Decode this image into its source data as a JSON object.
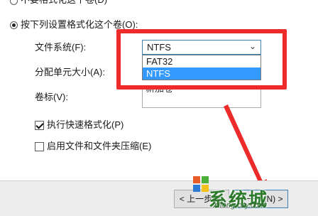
{
  "options": {
    "no_format_label": "不要格式化这个卷(D)",
    "format_label": "按下列设置格式化这个卷(O):"
  },
  "fields": {
    "filesystem_label": "文件系统(F):",
    "filesystem_value": "NTFS",
    "filesystem_options": [
      "FAT32",
      "NTFS"
    ],
    "allocation_label": "分配单元大小(A):",
    "volume_label_label": "卷标(V):",
    "volume_label_value": "新加卷"
  },
  "checkboxes": {
    "quick_format_label": "执行快速格式化(P)",
    "quick_format_checked": true,
    "compression_label": "启用文件和文件夹压缩(E)",
    "compression_checked": false
  },
  "footer": {
    "back_label": "< 上一步(B)",
    "next_label": "下一步(N) >"
  },
  "watermark": {
    "main": "系统城",
    "sub": "Xitong city.com"
  },
  "colors": {
    "highlight": "#ee2b2b",
    "selection": "#3399ff"
  }
}
